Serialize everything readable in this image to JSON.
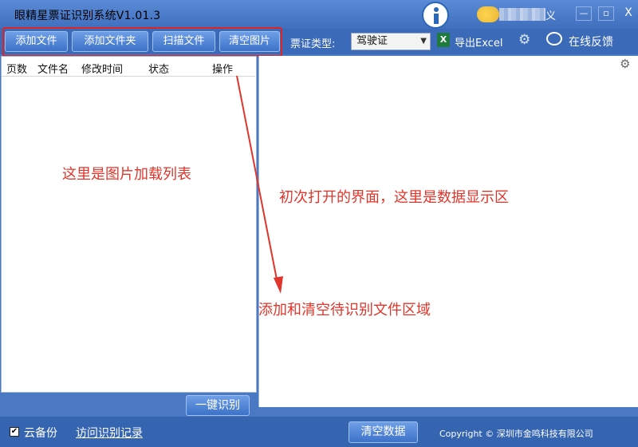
{
  "window": {
    "title": "眼精星票证识别系统V1.01.3",
    "user_tail": "义",
    "min_label": "—",
    "restore_label": "▫",
    "close_label": "X"
  },
  "toolbar": {
    "add_file": "添加文件",
    "add_folder": "添加文件夹",
    "scan_file": "扫描文件",
    "clear_images": "清空图片",
    "ticket_type_label": "票证类型:",
    "ticket_type_value": "驾驶证",
    "export_excel": "导出Excel",
    "feedback": "在线反馈",
    "excel_icon_letter": "X"
  },
  "list": {
    "columns": [
      "页数",
      "文件名",
      "修改时间",
      "状态",
      "操作"
    ]
  },
  "annotations": {
    "list_note": "这里是图片加载列表",
    "data_note": "初次打开的界面，这里是数据显示区",
    "area_note": "添加和清空待识别文件区域",
    "color": "#e0352b"
  },
  "actions": {
    "recognize_all": "一键识别",
    "clear_data": "清空数据"
  },
  "status": {
    "cloud_backup_label": "云备份",
    "cloud_backup_checked": true,
    "history_link": "访问识别记录",
    "copyright": "Copyright © 深圳市金鸣科技有限公司"
  },
  "icons": {
    "logo": "info-logo-icon",
    "settings": "gear-icon",
    "excel": "excel-icon",
    "feedback": "chat-bubble-icon"
  }
}
